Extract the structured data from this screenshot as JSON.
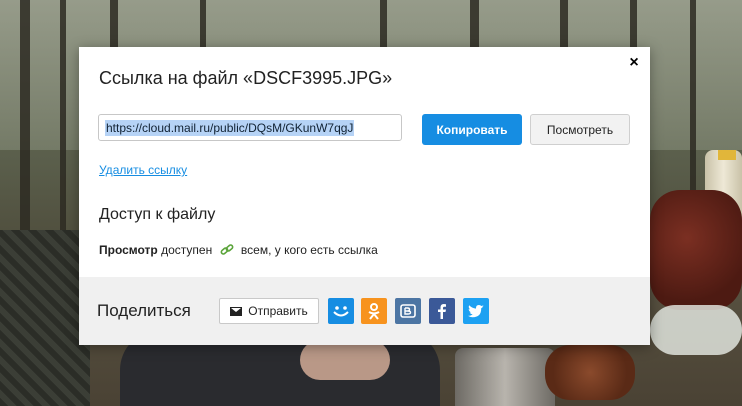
{
  "dialog": {
    "title": "Ссылка на файл «DSCF3995.JPG»",
    "close_label": "×",
    "url_value": "https://cloud.mail.ru/public/DQsM/GKunW7qgJ",
    "copy_label": "Копировать",
    "view_label": "Посмотреть",
    "delete_link_label": "Удалить ссылку",
    "access": {
      "title": "Доступ к файлу",
      "view_bold": "Просмотр",
      "available_text": "доступен",
      "who_text": "всем, у кого есть ссылка"
    },
    "share": {
      "label": "Поделиться",
      "send_label": "Отправить",
      "icons": [
        "mymail-icon",
        "odnoklassniki-icon",
        "vkontakte-icon",
        "facebook-icon",
        "twitter-icon"
      ]
    }
  },
  "colors": {
    "accent": "#168de2",
    "ok_orange": "#f7931e",
    "vk_blue": "#4c75a3",
    "fb_blue": "#3b5998",
    "twitter_blue": "#1da1f2",
    "link_green": "#5aa43a"
  }
}
